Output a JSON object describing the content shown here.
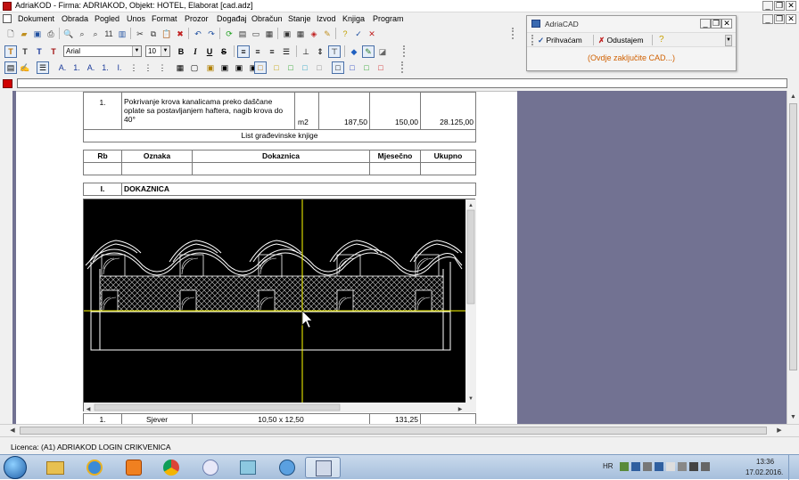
{
  "window": {
    "title": "AdriaKOD - Firma: ADRIAKOD,  Objekt: HOTEL, Elaborat [cad.adz]"
  },
  "menu": [
    "Dokument",
    "Obrada",
    "Pogled",
    "Unos",
    "Format",
    "Prozor",
    "Događaj",
    "Obračun",
    "Stanje",
    "Izvod",
    "Knjiga",
    "Program"
  ],
  "format_bar": {
    "font_name": "Arial",
    "font_size": "10",
    "bold": "B",
    "italic": "I",
    "underline": "U",
    "strike": "S"
  },
  "cad_window": {
    "title": "AdriaCAD",
    "accept_label": "Prihvaćam",
    "cancel_label": "Odustajem",
    "message": "(Ovdje zaključite CAD...)"
  },
  "document": {
    "item_row": {
      "rb": "1.",
      "description": "Pokrivanje krova kanalicama preko daščane oplate sa postavljanjem haftera, nagib krova do 40°",
      "unit": "m2",
      "quantity": "187,50",
      "price": "150,00",
      "total": "28.125,00"
    },
    "book_title": "List građevinske knjige",
    "columns": [
      "Rb",
      "Oznaka",
      "Dokaznica",
      "Mjesečno",
      "Ukupno"
    ],
    "section": {
      "number": "I.",
      "name": "DOKAZNICA"
    },
    "bottom_row": {
      "rb": "1.",
      "oznaka": "Sjever",
      "dokaznica": "10,50 x 12,50",
      "mjesecno": "131,25"
    }
  },
  "status": {
    "license": "Licenca: (A1) ADRIAKOD LOGIN CRIKVENICA"
  },
  "taskbar": {
    "lang": "HR",
    "time": "13:36",
    "date": "17.02.2016."
  },
  "colors": {
    "panel": "#727292",
    "cad_bg": "#000000",
    "cad_lines": "#ffffff",
    "crosshair": "#ffff00",
    "message": "#d06000"
  }
}
